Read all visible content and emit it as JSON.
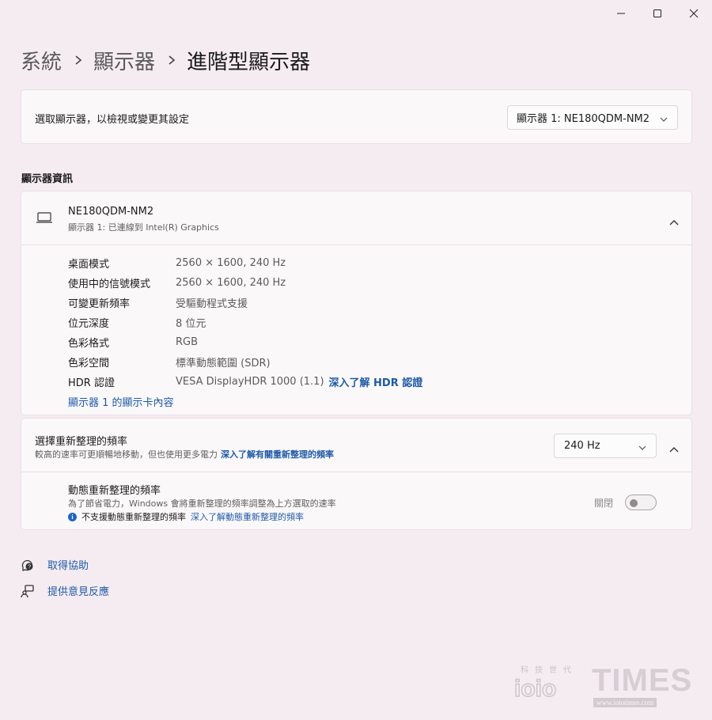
{
  "window": {
    "minimize_icon": "minimize-icon",
    "maximize_icon": "maximize-icon",
    "close_icon": "close-icon"
  },
  "breadcrumb": {
    "items": [
      "系統",
      "顯示器",
      "進階型顯示器"
    ]
  },
  "display_select": {
    "label": "選取顯示器，以檢視或變更其設定",
    "selected": "顯示器 1: NE180QDM-NM2"
  },
  "display_info": {
    "section_title": "顯示器資訊",
    "name": "NE180QDM-NM2",
    "connection": "顯示器 1: 已連線到 Intel(R) Graphics",
    "rows": [
      {
        "key": "桌面模式",
        "value": "2560 × 1600, 240 Hz"
      },
      {
        "key": "使用中的信號模式",
        "value": "2560 × 1600, 240 Hz"
      },
      {
        "key": "可變更新頻率",
        "value": "受驅動程式支援"
      },
      {
        "key": "位元深度",
        "value": "8 位元"
      },
      {
        "key": "色彩格式",
        "value": "RGB"
      },
      {
        "key": "色彩空間",
        "value": "標準動態範圍 (SDR)"
      },
      {
        "key": "HDR 認證",
        "value": "VESA DisplayHDR 1000 (1.1)"
      }
    ],
    "hdr_link": "深入了解 HDR 認證",
    "adapter_link": "顯示器 1 的顯示卡內容"
  },
  "refresh_rate": {
    "title": "選擇重新整理的頻率",
    "description": "較高的速率可更順暢地移動，但也使用更多電力",
    "learn_link": "深入了解有關重新整理的頻率",
    "selected": "240 Hz",
    "dynamic": {
      "title": "動態重新整理的頻率",
      "description": "為了節省電力，Windows 會將重新整理的頻率調整為上方選取的速率",
      "note": "不支援動態重新整理的頻率",
      "note_link": "深入了解動態重新整理的頻率",
      "toggle_label": "關閉",
      "toggle_on": false
    }
  },
  "footer": {
    "help": "取得協助",
    "feedback": "提供意見反應"
  },
  "watermark": {
    "top": "科技世代",
    "brand_left": "ioio",
    "brand_right": "TIMES",
    "url": "www.ioiotimes.com"
  }
}
